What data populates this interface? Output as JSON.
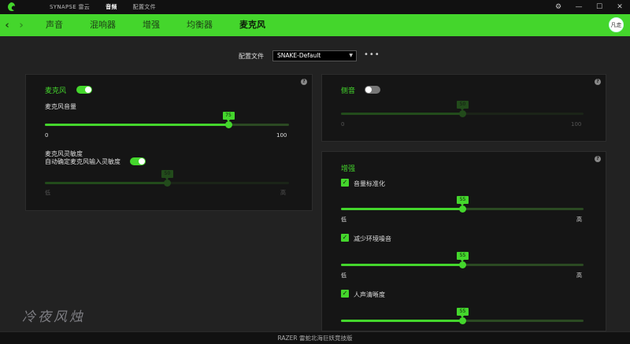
{
  "titlebar": {
    "tabs": [
      {
        "label": "SYNAPSE 雷云"
      },
      {
        "label": "音频"
      },
      {
        "label": "配置文件"
      }
    ],
    "window_controls": {
      "settings": "⚙",
      "minimize": "—",
      "maximize": "☐",
      "close": "✕"
    }
  },
  "navbar": {
    "back": "‹",
    "forward": "›",
    "items": [
      {
        "label": "声音"
      },
      {
        "label": "混响器"
      },
      {
        "label": "增强"
      },
      {
        "label": "均衡器"
      },
      {
        "label": "麦克风"
      }
    ],
    "avatar_text": "凡走"
  },
  "profile": {
    "label": "配置文件",
    "selected": "SNAKE-Default",
    "more": "•••"
  },
  "mic_panel": {
    "title": "麦克风",
    "enabled": true,
    "volume_label": "麦克风音量",
    "volume_value": "75",
    "volume_fraction": 0.75,
    "volume_min": "0",
    "volume_max": "100",
    "sensitivity_label": "麦克风灵敏度",
    "auto_label": "自动确定麦克风输入灵敏度",
    "auto_enabled": true,
    "sensitivity_value": "50",
    "sensitivity_fraction": 0.5,
    "sens_min": "低",
    "sens_max": "高"
  },
  "sidetone_panel": {
    "title": "侧音",
    "enabled": false,
    "value": "50",
    "fraction": 0.5,
    "min": "0",
    "max": "100"
  },
  "enhance_panel": {
    "title": "增强",
    "items": [
      {
        "label": "音量标准化",
        "checked": true,
        "value": "55",
        "fraction": 0.5,
        "min": "低",
        "max": "高"
      },
      {
        "label": "减少环境噪音",
        "checked": true,
        "value": "55",
        "fraction": 0.5,
        "min": "低",
        "max": "高"
      },
      {
        "label": "人声清晰度",
        "checked": true,
        "value": "55",
        "fraction": 0.5
      }
    ]
  },
  "watermark": "冷夜风烛",
  "footer": "RAZER 雷蛇北海巨妖竞技版",
  "colors": {
    "accent": "#44d62c",
    "panel": "#151515",
    "background": "#222222"
  }
}
